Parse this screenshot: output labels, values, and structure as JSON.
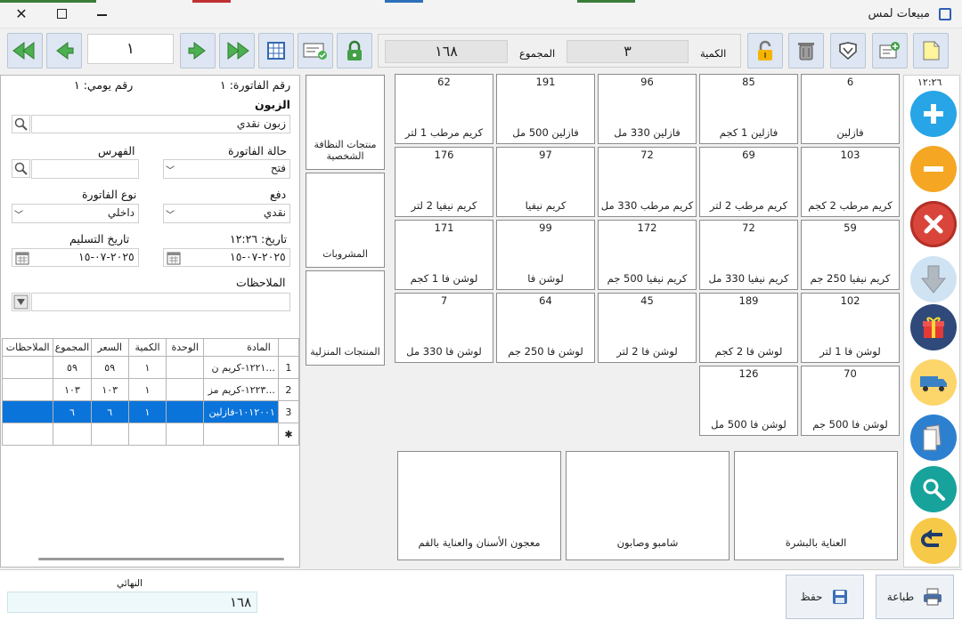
{
  "window": {
    "title": "مبيعات لمس"
  },
  "toolbar": {
    "record_number": "١",
    "quantity_label": "الكمية",
    "quantity_value": "٣",
    "total_label": "المجموع",
    "total_value": "١٦٨"
  },
  "invoice": {
    "invoice_number_label": "رقم الفاتورة: ١",
    "daily_number_label": "رقم يومي: ١",
    "customer_label": "الزبون",
    "customer_value": "زبون نقدي",
    "status_label": "حالة الفاتورة",
    "status_value": "فتح",
    "index_label": "الفهرس",
    "payment_label": "دفع",
    "payment_value": "نقدي",
    "invoice_type_label": "نوع الفاتورة",
    "invoice_type_value": "داخلي",
    "date_label": "تاريخ: ١٢:٢٦",
    "date_value": "٢٠٢٥-٠٧-١٥",
    "delivery_label": "تاريخ التسليم",
    "delivery_value": "٢٠٢٥-٠٧-١٥",
    "notes_label": "الملاحظات"
  },
  "grid": {
    "headers": [
      "المادة",
      "الوحدة",
      "الكمية",
      "السعر",
      "المجموع",
      "الملاحظات"
    ],
    "rows": [
      {
        "idx": "1",
        "item": "١٢٢١-كريم ن...",
        "unit": "",
        "qty": "١",
        "price": "٥٩",
        "total": "٥٩",
        "notes": ""
      },
      {
        "idx": "2",
        "item": "١٢٢٣-كريم مز...",
        "unit": "",
        "qty": "١",
        "price": "١٠٣",
        "total": "١٠٣",
        "notes": ""
      },
      {
        "idx": "3",
        "item": "١٠١٢٠٠١-فازلين",
        "unit": "",
        "qty": "١",
        "price": "٦",
        "total": "٦",
        "notes": ""
      }
    ]
  },
  "categories": [
    {
      "label": "منتجات النظافة الشخصية"
    },
    {
      "label": "المشروبات"
    },
    {
      "label": "المنتجات المنزلية"
    }
  ],
  "products": [
    {
      "count": "6",
      "name": "فازلين"
    },
    {
      "count": "85",
      "name": "فازلين 1 كجم"
    },
    {
      "count": "96",
      "name": "فازلين 330 مل"
    },
    {
      "count": "191",
      "name": "فازلين 500 مل"
    },
    {
      "count": "62",
      "name": "كريم مرطب 1 لتر"
    },
    {
      "count": "103",
      "name": "كريم مرطب 2 كجم"
    },
    {
      "count": "69",
      "name": "كريم مرطب 2 لتر"
    },
    {
      "count": "72",
      "name": "كريم مرطب 330 مل"
    },
    {
      "count": "97",
      "name": "كريم نيفيا"
    },
    {
      "count": "176",
      "name": "كريم نيفيا 2 لتر"
    },
    {
      "count": "59",
      "name": "كريم نيفيا 250 جم"
    },
    {
      "count": "72",
      "name": "كريم نيفيا 330 مل"
    },
    {
      "count": "172",
      "name": "كريم نيفيا 500 جم"
    },
    {
      "count": "99",
      "name": "لوشن فا"
    },
    {
      "count": "171",
      "name": "لوشن فا 1 كجم"
    },
    {
      "count": "102",
      "name": "لوشن فا 1 لتر"
    },
    {
      "count": "189",
      "name": "لوشن فا 2 كجم"
    },
    {
      "count": "45",
      "name": "لوشن فا 2 لتر"
    },
    {
      "count": "64",
      "name": "لوشن فا 250 جم"
    },
    {
      "count": "7",
      "name": "لوشن فا 330 مل"
    },
    {
      "count": "70",
      "name": "لوشن فا 500 جم"
    },
    {
      "count": "126",
      "name": "لوشن فا 500 مل"
    }
  ],
  "subcategories": [
    {
      "label": "العناية بالبشرة"
    },
    {
      "label": "شامبو وصابون"
    },
    {
      "label": "معجون الأسنان والعناية بالفم"
    }
  ],
  "sidebar": {
    "time": "١٢:٢٦"
  },
  "footer": {
    "final_label": "النهائي",
    "final_value": "١٦٨",
    "save_label": "حفظ",
    "print_label": "طباعة"
  }
}
